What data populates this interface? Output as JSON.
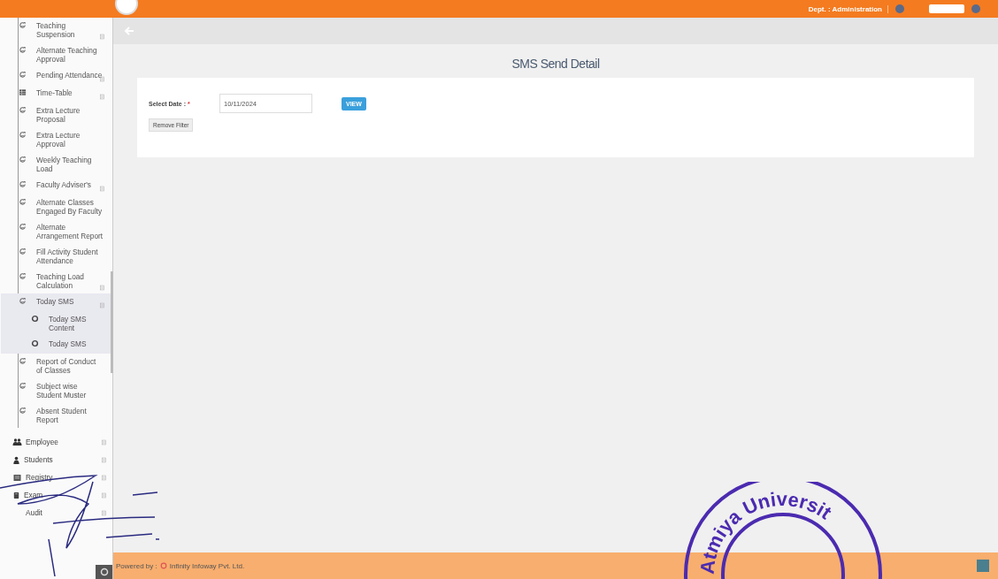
{
  "header": {
    "department": "Dept. : Administration"
  },
  "sidebar": {
    "items": [
      {
        "label": "Teaching Suspension",
        "kind": "link",
        "expandable": true,
        "expanded": false
      },
      {
        "label": "Alternate Teaching Approval",
        "kind": "link",
        "expandable": false,
        "expanded": false
      },
      {
        "label": "Pending Attendance",
        "kind": "link",
        "expandable": true,
        "expanded": false
      },
      {
        "label": "Time-Table",
        "kind": "timetable",
        "expandable": true,
        "expanded": false
      },
      {
        "label": "Extra Lecture Proposal",
        "kind": "link",
        "expandable": false,
        "expanded": false
      },
      {
        "label": "Extra Lecture Approval",
        "kind": "link",
        "expandable": false,
        "expanded": false
      },
      {
        "label": "Weekly Teaching Load",
        "kind": "link",
        "expandable": false,
        "expanded": false
      },
      {
        "label": "Faculty Adviser's",
        "kind": "link",
        "expandable": true,
        "expanded": false
      },
      {
        "label": "Alternate Classes Engaged By Faculty",
        "kind": "link",
        "expandable": false,
        "expanded": false
      },
      {
        "label": "Alternate Arrangement Report",
        "kind": "link",
        "expandable": false,
        "expanded": false
      },
      {
        "label": "Fill Activity Student Attendance",
        "kind": "link",
        "expandable": false,
        "expanded": false
      },
      {
        "label": "Teaching Load Calculation",
        "kind": "link",
        "expandable": true,
        "expanded": false
      },
      {
        "label": "Today SMS",
        "kind": "link",
        "expandable": true,
        "expanded": true,
        "children": [
          {
            "label": "Today SMS Content",
            "kind": "leaf"
          },
          {
            "label": "Today SMS",
            "kind": "leaf"
          }
        ]
      },
      {
        "label": "Report of Conduct of Classes",
        "kind": "link",
        "expandable": false,
        "expanded": false
      },
      {
        "label": "Subject wise Student Muster",
        "kind": "link",
        "expandable": false,
        "expanded": false
      },
      {
        "label": "Absent Student Report",
        "kind": "link",
        "expandable": false,
        "expanded": false
      }
    ],
    "modules": [
      {
        "label": "Employee",
        "kind": "employee",
        "expandable": true
      },
      {
        "label": "Students",
        "kind": "students",
        "expandable": true
      },
      {
        "label": "Registry",
        "kind": "registry",
        "expandable": true
      },
      {
        "label": "Exam",
        "kind": "exam",
        "expandable": true
      },
      {
        "label": "Audit",
        "kind": "audit",
        "expandable": true
      }
    ]
  },
  "page": {
    "title": "SMS Send Detail"
  },
  "filter": {
    "date_label": "Select Date :",
    "required_mark": "*",
    "date_value": "10/11/2024",
    "view_button": "VIEW",
    "remove_button": "Remove Filter"
  },
  "footer": {
    "powered_by": "Powered by :",
    "company": "Infinity Infoway Pvt. Ltd."
  },
  "stamp": {
    "text": "Atmiya Universit"
  }
}
